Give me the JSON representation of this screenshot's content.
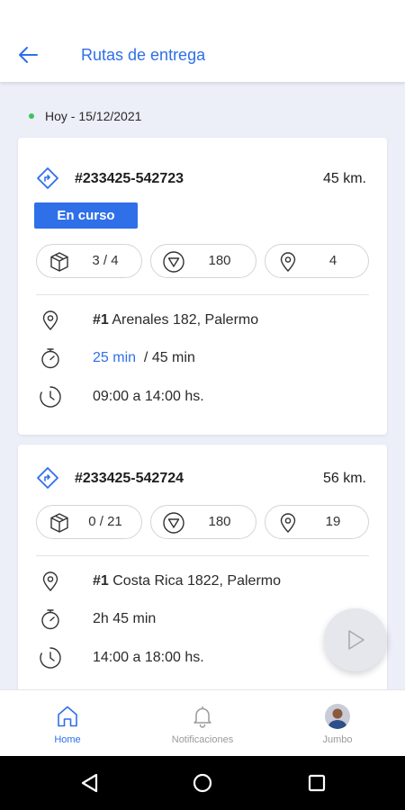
{
  "header": {
    "title": "Rutas de entrega"
  },
  "date_label": "Hoy - 15/12/2021",
  "routes": [
    {
      "id": "#233425-542723",
      "distance": "45 km.",
      "status": "En curso",
      "packages": "3 / 4",
      "volume": "180",
      "stops": "4",
      "address_number": "#1",
      "address": "Arenales 182, Palermo",
      "time_elapsed": "25 min",
      "time_total": "/ 45 min",
      "schedule": "09:00 a 14:00 hs."
    },
    {
      "id": "#233425-542724",
      "distance": "56 km.",
      "packages": "0 / 21",
      "volume": "180",
      "stops": "19",
      "address_number": "#1",
      "address": "Costa Rica 1822, Palermo",
      "duration": "2h 45 min",
      "schedule": "14:00 a 18:00 hs."
    }
  ],
  "nav": {
    "home": "Home",
    "notifications": "Notificaciones",
    "profile": "Jumbo"
  },
  "icons": {
    "back": "arrow-left-icon",
    "route": "route-diamond-icon",
    "package": "box-icon",
    "volume": "triangle-down-icon",
    "stops": "map-pin-icon",
    "timer": "stopwatch-icon",
    "clock": "clock-icon",
    "play": "play-icon",
    "home": "home-icon",
    "bell": "bell-icon"
  },
  "colors": {
    "accent": "#2f6fe8",
    "status_dot": "#3fc35a",
    "background": "#eceef8"
  }
}
